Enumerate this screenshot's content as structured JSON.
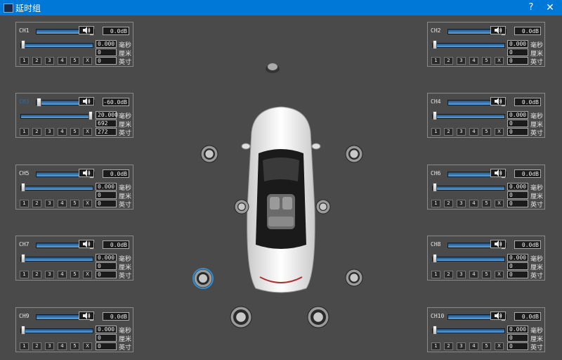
{
  "window": {
    "title": "延时组",
    "help": "?",
    "close": "✕"
  },
  "units": {
    "ms": "毫秒",
    "cm": "厘米",
    "inch": "英寸"
  },
  "toggles": [
    "1",
    "2",
    "3",
    "4",
    "5",
    "X"
  ],
  "channels": [
    {
      "name": "CH1",
      "db": "0.0dB",
      "gain_level": 1.0,
      "delay_level": 0.0,
      "ms": "0.000",
      "cm": "0",
      "inch": "0",
      "enabled": true
    },
    {
      "name": "CH2",
      "db": "0.0dB",
      "gain_level": 1.0,
      "delay_level": 0.0,
      "ms": "0.000",
      "cm": "0",
      "inch": "0",
      "enabled": true
    },
    {
      "name": "CH3",
      "db": "-60.0dB",
      "gain_level": 0.0,
      "delay_level": 1.0,
      "ms": "20.000",
      "cm": "692",
      "inch": "272",
      "enabled": false
    },
    {
      "name": "CH4",
      "db": "0.0dB",
      "gain_level": 1.0,
      "delay_level": 0.0,
      "ms": "0.000",
      "cm": "0",
      "inch": "0",
      "enabled": true
    },
    {
      "name": "CH5",
      "db": "0.0dB",
      "gain_level": 1.0,
      "delay_level": 0.0,
      "ms": "0.000",
      "cm": "0",
      "inch": "0",
      "enabled": true
    },
    {
      "name": "CH6",
      "db": "0.0dB",
      "gain_level": 1.0,
      "delay_level": 0.0,
      "ms": "0.000",
      "cm": "0",
      "inch": "0",
      "enabled": true
    },
    {
      "name": "CH7",
      "db": "0.0dB",
      "gain_level": 1.0,
      "delay_level": 0.0,
      "ms": "0.000",
      "cm": "0",
      "inch": "0",
      "enabled": true
    },
    {
      "name": "CH8",
      "db": "0.0dB",
      "gain_level": 1.0,
      "delay_level": 0.0,
      "ms": "0.000",
      "cm": "0",
      "inch": "0",
      "enabled": true
    },
    {
      "name": "CH9",
      "db": "0.0dB",
      "gain_level": 1.0,
      "delay_level": 0.0,
      "ms": "0.000",
      "cm": "0",
      "inch": "0",
      "enabled": true
    },
    {
      "name": "CH10",
      "db": "0.0dB",
      "gain_level": 1.0,
      "delay_level": 0.0,
      "ms": "0.000",
      "cm": "0",
      "inch": "0",
      "enabled": true
    }
  ],
  "icons": {
    "speaker_button": "speaker-volume-icon",
    "car": "car-top-view-icon",
    "speaker": "loudspeaker-icon"
  },
  "colors": {
    "titlebar": "#0078d7",
    "background": "#4a4a4a",
    "slider_fill": "#3d86c6",
    "disabled_name": "#2a6fa8",
    "selected_speaker_ring": "#2f8fd8"
  }
}
